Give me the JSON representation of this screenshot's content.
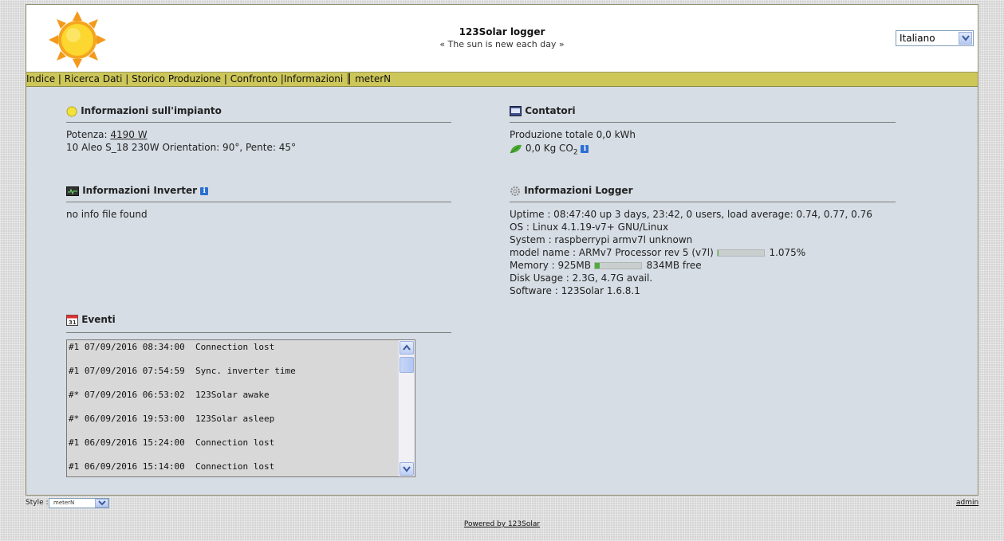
{
  "header": {
    "title": "123Solar logger",
    "tagline": "« The sun is new each day »",
    "language": "Italiano"
  },
  "menu": [
    {
      "label": "Indice"
    },
    {
      "label": "Ricerca Dati"
    },
    {
      "label": "Storico Produzione"
    },
    {
      "label": "Confronto"
    },
    {
      "label": "Informazioni"
    },
    {
      "label": "meterN"
    }
  ],
  "impianto": {
    "title": "Informazioni sull'impianto",
    "power_label": "Potenza:",
    "power_value": "4190 W",
    "description": "10 Aleo S_18 230W Orientation: 90°, Pente: 45°"
  },
  "contatori": {
    "title": "Contatori",
    "production": "Produzione totale 0,0 kWh",
    "co2_value": "0,0 Kg CO",
    "co2_sub": "2"
  },
  "inverter": {
    "title": "Informazioni Inverter",
    "info": "no info file found"
  },
  "logger": {
    "title": "Informazioni Logger",
    "uptime": "Uptime : 08:47:40 up 3 days, 23:42, 0 users, load average: 0.74, 0.77, 0.76",
    "os": "OS : Linux 4.1.19-v7+ GNU/Linux",
    "system": "System : raspberrypi armv7l unknown",
    "model": "model name : ARMv7 Processor rev 5 (v7l)",
    "cpu_percent": "1.075%",
    "cpu_fraction": 0.01075,
    "memory_total": "Memory : 925MB",
    "memory_free": "834MB free",
    "memory_used_fraction": 0.0984,
    "disk": "Disk Usage : 2.3G, 4.7G avail.",
    "software": "Software : 123Solar 1.6.8.1"
  },
  "eventi": {
    "title": "Eventi",
    "rows": [
      "#1 07/09/2016 08:34:00  Connection lost",
      "#1 07/09/2016 07:54:59  Sync. inverter time",
      "#* 07/09/2016 06:53:02  123Solar awake",
      "#* 06/09/2016 19:53:00  123Solar asleep",
      "#1 06/09/2016 15:24:00  Connection lost",
      "#1 06/09/2016 15:14:00  Connection lost"
    ]
  },
  "footer": {
    "style_label": "Style :",
    "style_value": "meterN",
    "admin": "admin",
    "powered": "Powered by 123Solar"
  },
  "colors": {
    "menubar": "#cdc75a",
    "content_bg": "#d6dde4",
    "bar_fill": "#4fae3a",
    "info_icon": "#2c6fd0"
  }
}
